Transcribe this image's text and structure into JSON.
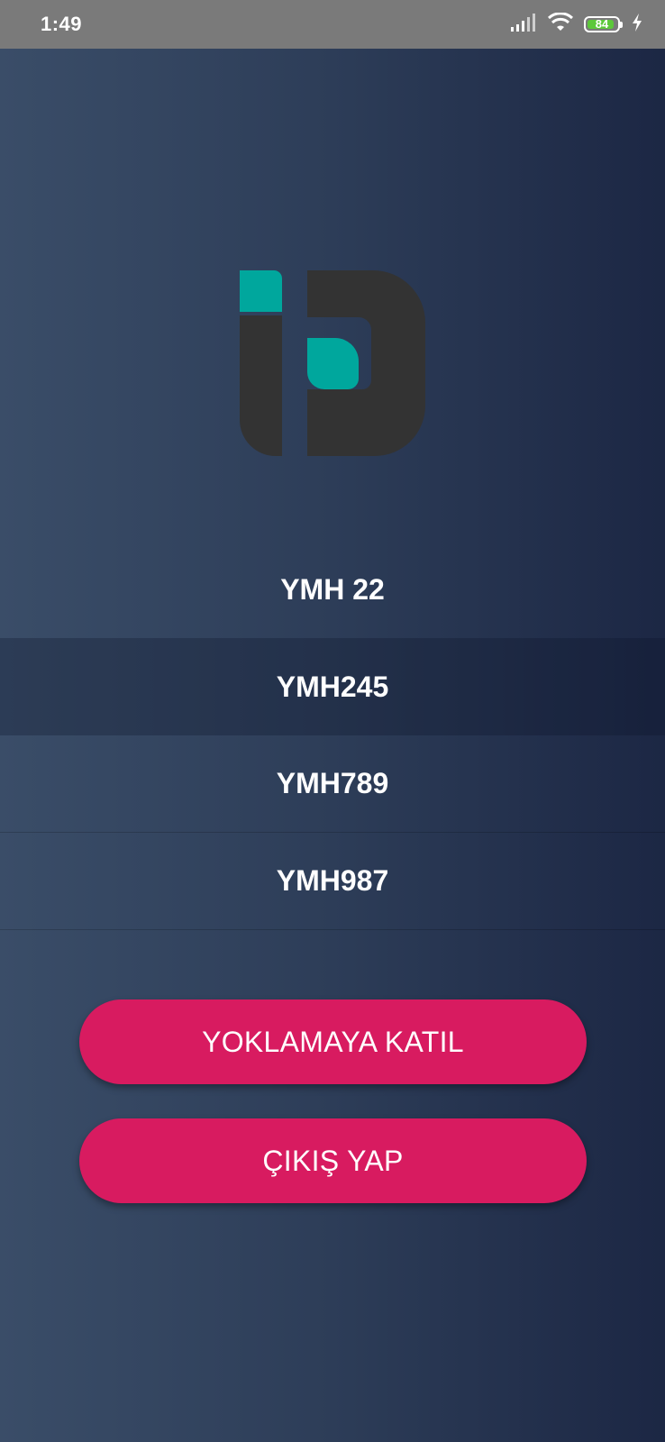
{
  "status_bar": {
    "time": "1:49",
    "battery_level": "84",
    "icons": [
      "signal-icon",
      "wifi-icon",
      "battery-icon",
      "charging-icon"
    ]
  },
  "logo": {
    "colors": {
      "teal": "#00a79d",
      "dark": "#333333"
    }
  },
  "class_list": {
    "items": [
      {
        "label": "YMH 22",
        "selected": false
      },
      {
        "label": "YMH245",
        "selected": true
      },
      {
        "label": "YMH789",
        "selected": false
      },
      {
        "label": "YMH987",
        "selected": false
      }
    ]
  },
  "actions": {
    "join_label": "YOKLAMAYA KATIL",
    "exit_label": "ÇIKIŞ YAP"
  },
  "theme": {
    "accent": "#d81b60",
    "background_left": "#3a4d68",
    "background_right": "#1c2744",
    "battery_green": "#5cc83a"
  }
}
